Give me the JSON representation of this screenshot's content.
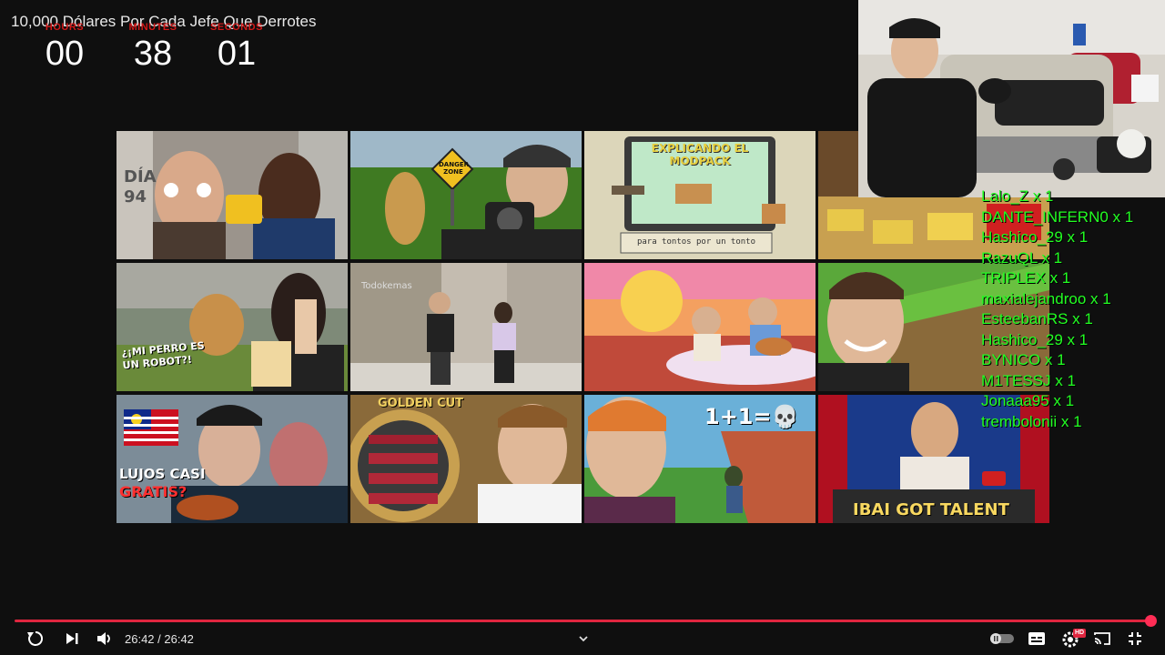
{
  "video": {
    "title": "10,000 Dólares Por Cada Jefe Que Derrotes"
  },
  "timer": {
    "hours_label": "HOURS",
    "hours_value": "00",
    "minutes_label": "MINUTES",
    "minutes_value": "38",
    "seconds_label": "SECONDS",
    "seconds_value": "01"
  },
  "thumbnails": [
    {
      "caption": "DÍA 94",
      "sub": ""
    },
    {
      "caption": "DANGER ZONE",
      "sub": ""
    },
    {
      "caption": "EXPLICANDO EL MODPACK",
      "sub": "para tontos por un tonto"
    },
    {
      "caption": "",
      "sub": ""
    },
    {
      "caption": "¿¡MI PERRO ES UN ROBOT?!",
      "sub": ""
    },
    {
      "caption": "Todokemas",
      "sub": ""
    },
    {
      "caption": "",
      "sub": ""
    },
    {
      "caption": "",
      "sub": ""
    },
    {
      "caption": "LUJOS CASI",
      "sub": "GRATIS?"
    },
    {
      "caption": "GOLDEN CUT",
      "sub": ""
    },
    {
      "caption": "1+1=💀",
      "sub": ""
    },
    {
      "caption": "IBAI GOT TALENT",
      "sub": ""
    }
  ],
  "chat": {
    "lines": [
      "Lalo_Z x 1",
      "DANTE_INFERN0 x 1",
      "Hashico_29 x 1",
      "RazuQL x 1",
      "TRIPLEX x 1",
      "maxialejandroo x 1",
      "EsteebanRS x 1",
      "Hashico_29 x 1",
      "BYNICO x 1",
      "M1TESSJ x 1",
      "Jonaaa95 x 1",
      "trembolonii x 1"
    ]
  },
  "player": {
    "current_time": "26:42 / 26:42",
    "progress": 1.0,
    "autoplay_on": false,
    "quality_badge": "HD"
  },
  "colors": {
    "accent": "#e0263f",
    "timer_label": "#d01818",
    "chat": "#22ff22"
  }
}
